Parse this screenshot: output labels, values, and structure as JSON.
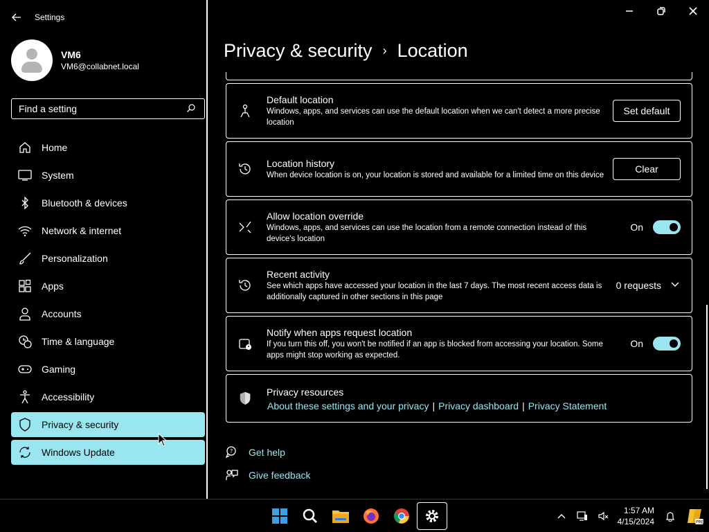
{
  "app": {
    "title": "Settings"
  },
  "profile": {
    "name": "VM6",
    "email": "VM6@collabnet.local"
  },
  "search": {
    "placeholder": "Find a setting"
  },
  "nav": {
    "items": [
      {
        "label": "Home",
        "icon": "home-icon"
      },
      {
        "label": "System",
        "icon": "monitor-icon"
      },
      {
        "label": "Bluetooth & devices",
        "icon": "bluetooth-icon"
      },
      {
        "label": "Network & internet",
        "icon": "wifi-icon"
      },
      {
        "label": "Personalization",
        "icon": "brush-icon"
      },
      {
        "label": "Apps",
        "icon": "apps-icon"
      },
      {
        "label": "Accounts",
        "icon": "person-icon"
      },
      {
        "label": "Time & language",
        "icon": "clock-globe-icon"
      },
      {
        "label": "Gaming",
        "icon": "gamepad-icon"
      },
      {
        "label": "Accessibility",
        "icon": "accessibility-icon"
      },
      {
        "label": "Privacy & security",
        "icon": "shield-icon",
        "active": true
      },
      {
        "label": "Windows Update",
        "icon": "update-icon"
      }
    ]
  },
  "header": {
    "section": "Privacy & security",
    "separator": "›",
    "page": "Location"
  },
  "cards": {
    "default_location": {
      "title": "Default location",
      "desc": "Windows, apps, and services can use the default location when we can't detect a more precise location",
      "button": "Set default"
    },
    "location_history": {
      "title": "Location history",
      "desc": "When device location is on, your location is stored and available for a limited time on this device",
      "button": "Clear"
    },
    "location_override": {
      "title": "Allow location override",
      "desc": "Windows, apps, and services can use the location from a remote connection instead of this device's location",
      "toggle_label": "On"
    },
    "recent_activity": {
      "title": "Recent activity",
      "desc": "See which apps have accessed your location in the last 7 days. The most recent access data is additionally captured in other sections in this page",
      "value": "0 requests"
    },
    "notify": {
      "title": "Notify when apps request location",
      "desc": "If you turn this off, you won't be notified if an app is blocked from accessing your location. Some apps might stop working as expected.",
      "toggle_label": "On"
    },
    "privacy_resources": {
      "title": "Privacy resources",
      "links": [
        "About these settings and your privacy",
        "Privacy dashboard",
        "Privacy Statement"
      ]
    }
  },
  "help": {
    "get_help": "Get help",
    "give_feedback": "Give feedback"
  },
  "taskbar": {
    "time": "1:57 AM",
    "date": "4/15/2024"
  },
  "colors": {
    "accent": "#99e6f0",
    "background": "#000000",
    "foreground": "#ffffff"
  }
}
